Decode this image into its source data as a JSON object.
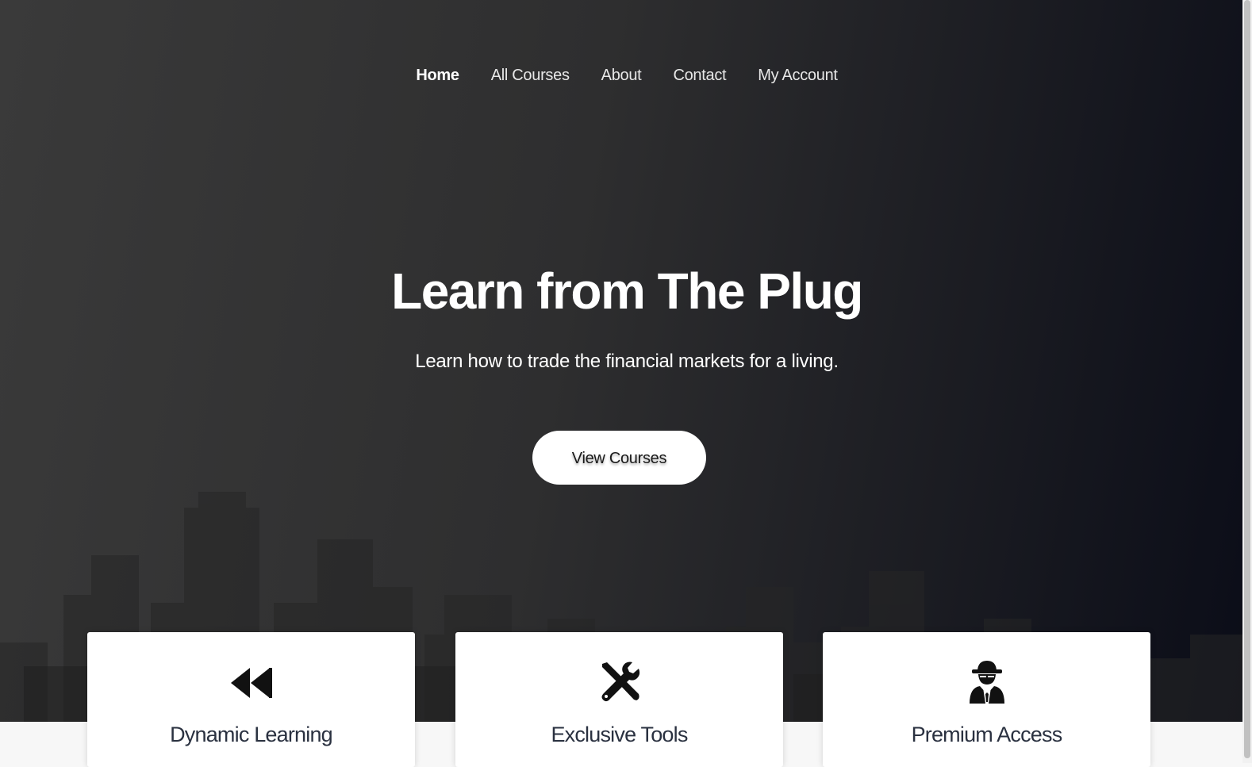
{
  "nav": {
    "items": [
      {
        "label": "Home",
        "active": true
      },
      {
        "label": "All Courses",
        "active": false
      },
      {
        "label": "About",
        "active": false
      },
      {
        "label": "Contact",
        "active": false
      },
      {
        "label": "My Account",
        "active": false
      }
    ]
  },
  "hero": {
    "title": "Learn from The Plug",
    "subtitle": "Learn how to trade the financial markets for a living.",
    "cta_label": "View Courses"
  },
  "features": [
    {
      "title": "Dynamic Learning",
      "icon": "rewind-icon"
    },
    {
      "title": "Exclusive Tools",
      "icon": "tools-icon"
    },
    {
      "title": "Premium Access",
      "icon": "user-secret-icon"
    }
  ],
  "colors": {
    "hero_dark": "#2e2e2f",
    "hero_navy": "#0b0d18",
    "card_title": "#2a3140"
  }
}
